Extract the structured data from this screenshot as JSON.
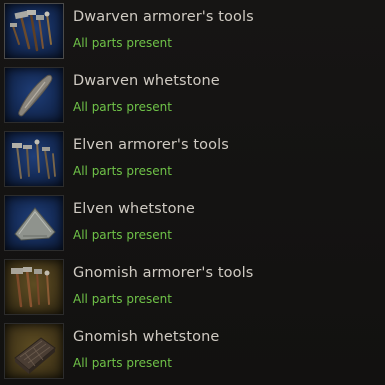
{
  "colors": {
    "status_ok": "#6fc248",
    "name_text": "#cfcac2",
    "slot_blue": "#1f3e78",
    "slot_gold": "#5e4d22"
  },
  "items": [
    {
      "name": "Dwarven armorer's tools",
      "status": "All parts present",
      "icon": "tools-icon",
      "rarity": "blue"
    },
    {
      "name": "Dwarven whetstone",
      "status": "All parts present",
      "icon": "whetstone-icon",
      "rarity": "blue"
    },
    {
      "name": "Elven armorer's tools",
      "status": "All parts present",
      "icon": "tools-icon",
      "rarity": "blue"
    },
    {
      "name": "Elven whetstone",
      "status": "All parts present",
      "icon": "whetstone-icon",
      "rarity": "blue"
    },
    {
      "name": "Gnomish armorer's tools",
      "status": "All parts present",
      "icon": "tools-icon",
      "rarity": "gold"
    },
    {
      "name": "Gnomish whetstone",
      "status": "All parts present",
      "icon": "whetstone-icon",
      "rarity": "gold"
    }
  ]
}
